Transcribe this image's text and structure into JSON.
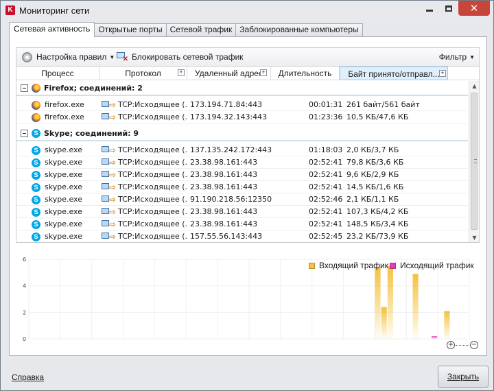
{
  "window": {
    "title": "Мониторинг сети"
  },
  "tabs": [
    {
      "label": "Сетевая активность",
      "active": true
    },
    {
      "label": "Открытые порты",
      "active": false
    },
    {
      "label": "Сетевой трафик",
      "active": false
    },
    {
      "label": "Заблокированные компьютеры",
      "active": false
    }
  ],
  "toolbar": {
    "rules_label": "Настройка правил",
    "block_label": "Блокировать сетевой трафик",
    "filter_label": "Фильтр"
  },
  "columns": [
    "Процесс",
    "Протокол",
    "Удаленный адрес",
    "Длительность",
    "Байт принято/отправл..."
  ],
  "groups": [
    {
      "label": "Firefox; соединений: 2",
      "rows": [
        {
          "process": "firefox.exe",
          "protocol": "TCP:Исходящее (...",
          "address": "173.194.71.84:443",
          "duration": "00:01:31",
          "bytes": "261 байт/561 байт"
        },
        {
          "process": "firefox.exe",
          "protocol": "TCP:Исходящее (...",
          "address": "173.194.32.143:443",
          "duration": "01:23:36",
          "bytes": "10,5 КБ/47,6 КБ"
        }
      ]
    },
    {
      "label": "Skype; соединений: 9",
      "rows": [
        {
          "process": "skype.exe",
          "protocol": "TCP:Исходящее (...",
          "address": "137.135.242.172:443",
          "duration": "01:18:03",
          "bytes": "2,0 КБ/3,7 КБ"
        },
        {
          "process": "skype.exe",
          "protocol": "TCP:Исходящее (...",
          "address": "23.38.98.161:443",
          "duration": "02:52:41",
          "bytes": "79,8 КБ/3,6 КБ"
        },
        {
          "process": "skype.exe",
          "protocol": "TCP:Исходящее (...",
          "address": "23.38.98.161:443",
          "duration": "02:52:41",
          "bytes": "9,6 КБ/2,9 КБ"
        },
        {
          "process": "skype.exe",
          "protocol": "TCP:Исходящее (...",
          "address": "23.38.98.161:443",
          "duration": "02:52:41",
          "bytes": "14,5 КБ/1,6 КБ"
        },
        {
          "process": "skype.exe",
          "protocol": "TCP:Исходящее (...",
          "address": "91.190.218.56:12350",
          "duration": "02:52:46",
          "bytes": "2,1 КБ/1,1 КБ"
        },
        {
          "process": "skype.exe",
          "protocol": "TCP:Исходящее (...",
          "address": "23.38.98.161:443",
          "duration": "02:52:41",
          "bytes": "107,3 КБ/4,2 КБ"
        },
        {
          "process": "skype.exe",
          "protocol": "TCP:Исходящее (...",
          "address": "23.38.98.161:443",
          "duration": "02:52:41",
          "bytes": "148,5 КБ/3,4 КБ"
        },
        {
          "process": "skype.exe",
          "protocol": "TCP:Исходящее (...",
          "address": "157.55.56.143:443",
          "duration": "02:52:45",
          "bytes": "23,2 КБ/73,9 КБ"
        }
      ]
    }
  ],
  "chart": {
    "y_ticks": [
      "6",
      "4",
      "2",
      "0"
    ],
    "legend": [
      {
        "label": "Входящий трафик",
        "color": "#f5c23d"
      },
      {
        "label": "Исходящий трафик",
        "color": "#e23fb0"
      }
    ]
  },
  "chart_data": {
    "type": "bar",
    "ylim": [
      0,
      6
    ],
    "series": [
      {
        "name": "Входящий трафик",
        "points": [
          [
            55,
            5.4
          ],
          [
            56,
            2.4
          ],
          [
            57,
            5.5
          ],
          [
            61,
            4.9
          ],
          [
            66,
            2.1
          ]
        ]
      },
      {
        "name": "Исходящий трафик",
        "points": [
          [
            64,
            0.2
          ]
        ]
      }
    ],
    "x_count": 70
  },
  "footer": {
    "help_label": "Справка",
    "close_label": "Закрыть"
  }
}
